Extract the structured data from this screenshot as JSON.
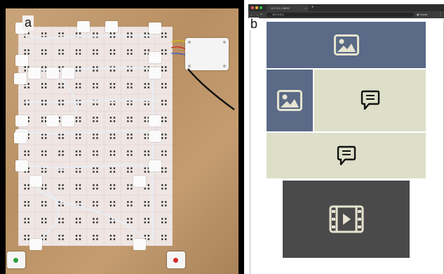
{
  "panel_a": {
    "label": "a"
  },
  "panel_b": {
    "label": "b",
    "browser": {
      "tab_title": "127.0.0.1:8000",
      "address": "127.0.0.1",
      "profile_label": "Guest"
    },
    "tiles": [
      {
        "kind": "image",
        "icon": "image-icon"
      },
      {
        "kind": "image",
        "icon": "image-icon"
      },
      {
        "kind": "text",
        "icon": "chat-bubble-icon"
      },
      {
        "kind": "text",
        "icon": "chat-bubble-icon"
      },
      {
        "kind": "video",
        "icon": "film-play-icon"
      }
    ]
  },
  "colors": {
    "image_tile": "#5a6a87",
    "text_tile": "#dedfc9",
    "video_tile": "#4a4a4a",
    "icon_light": "#e6e4d0",
    "icon_dark": "#111111",
    "led_green": "#2e9e3e",
    "led_red": "#d42a2a"
  }
}
